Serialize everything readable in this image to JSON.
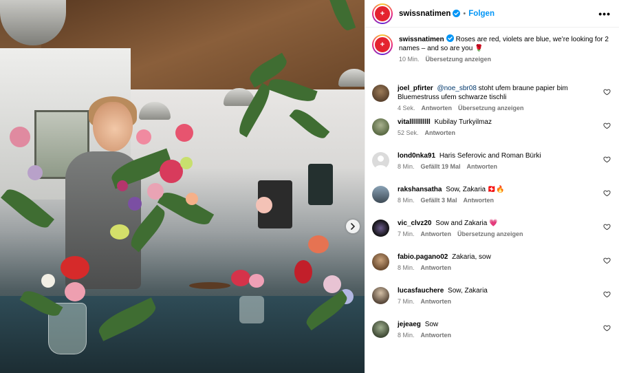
{
  "post": {
    "username": "swissnatimen",
    "follow_label": "Folgen",
    "caption": "Roses are red, violets are blue, we’re looking for 2 names – and so are you 🌹",
    "caption_time": "10 Min.",
    "translate_label": "Übersetzung anzeigen"
  },
  "comments": [
    {
      "username": "joel_pfirter",
      "mention": "@noe_sbr08",
      "text": "stoht ufem braune papier bim Bluemestruss ufem schwarze tischli",
      "time": "4 Sek.",
      "likes": "",
      "reply": "Antworten",
      "translate": "Übersetzung anzeigen"
    },
    {
      "username": "vitalllllllllll",
      "mention": "",
      "text": "Kubilay Turkyilmaz",
      "time": "52 Sek.",
      "likes": "",
      "reply": "Antworten",
      "translate": ""
    },
    {
      "username": "lond0nka91",
      "mention": "",
      "text": "Haris Seferovic and Roman Bürki",
      "time": "8 Min.",
      "likes": "Gefällt 19 Mal",
      "reply": "Antworten",
      "translate": ""
    },
    {
      "username": "rakshansatha",
      "mention": "",
      "text": "Sow, Zakaria 🇨🇭🔥",
      "time": "8 Min.",
      "likes": "Gefällt 3 Mal",
      "reply": "Antworten",
      "translate": ""
    },
    {
      "username": "vic_clvz20",
      "mention": "",
      "text": "Sow and Zakaria 💗",
      "time": "7 Min.",
      "likes": "",
      "reply": "Antworten",
      "translate": "Übersetzung anzeigen"
    },
    {
      "username": "fabio.pagano02",
      "mention": "",
      "text": "Zakaria, sow",
      "time": "8 Min.",
      "likes": "",
      "reply": "Antworten",
      "translate": ""
    },
    {
      "username": "lucasfauchere",
      "mention": "",
      "text": "Sow, Zakaria",
      "time": "7 Min.",
      "likes": "",
      "reply": "Antworten",
      "translate": ""
    },
    {
      "username": "jejeaeg",
      "mention": "",
      "text": "Sow",
      "time": "8 Min.",
      "likes": "",
      "reply": "Antworten",
      "translate": ""
    }
  ],
  "colors": {
    "brand_red": "#e4232f",
    "link_blue": "#0095f6",
    "meta_gray": "#737373",
    "verified_blue": "#0095f6"
  },
  "icons": {
    "more": "more-options-icon",
    "heart": "heart-icon",
    "verified": "verified-badge-icon",
    "next": "chevron-right-icon"
  }
}
